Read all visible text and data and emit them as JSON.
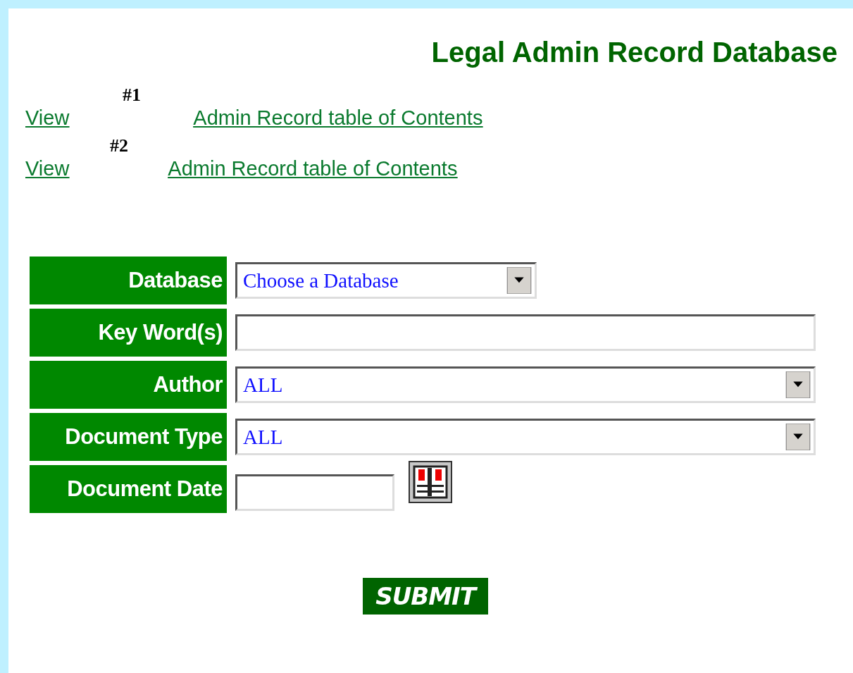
{
  "title": "Legal Admin Record Database",
  "links": [
    {
      "number": "#1",
      "verb": "View",
      "label": "Admin Record table of Contents"
    },
    {
      "number": "#2",
      "verb": "View",
      "label": "Admin Record table of Contents"
    }
  ],
  "form": [
    {
      "label": "Database",
      "kind": "short-select",
      "value": "Choose a Database"
    },
    {
      "label": "Key Word(s)",
      "kind": "text"
    },
    {
      "label": "Author",
      "kind": "select",
      "value": "ALL"
    },
    {
      "label": "Document Type",
      "kind": "select",
      "value": "ALL"
    },
    {
      "label": "Document Date",
      "kind": "date"
    }
  ],
  "submit": "SUBMIT"
}
